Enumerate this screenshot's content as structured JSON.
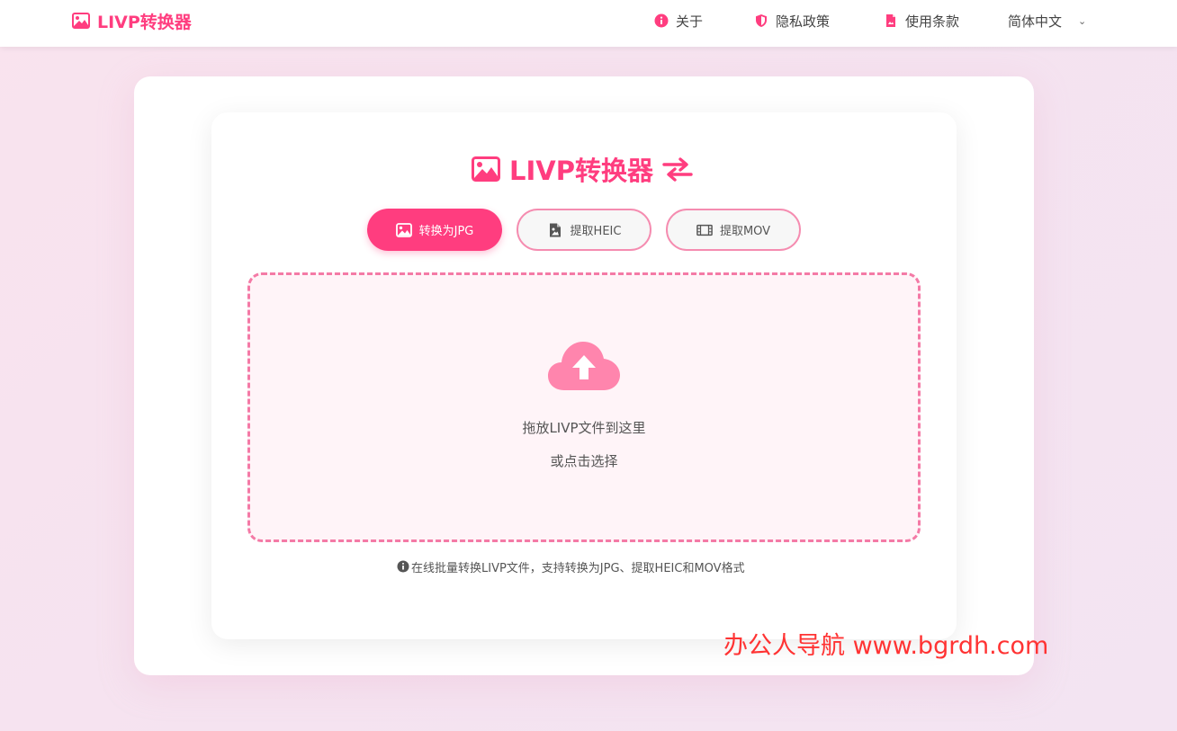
{
  "header": {
    "brand": "LIVP转换器",
    "nav": {
      "about": "关于",
      "privacy": "隐私政策",
      "terms": "使用条款",
      "language": "简体中文"
    }
  },
  "main": {
    "title": "LIVP转换器",
    "tabs": {
      "jpg": "转换为JPG",
      "heic": "提取HEIC",
      "mov": "提取MOV"
    },
    "dropzone": {
      "line1": "拖放LIVP文件到这里",
      "line2": "或点击选择"
    },
    "footnote": "在线批量转换LIVP文件，支持转换为JPG、提取HEIC和MOV格式"
  },
  "watermark": "办公人导航 www.bgrdh.com",
  "colors": {
    "accent": "#ff3d7f",
    "cloud": "#ff85ad",
    "dropzone_border": "#f47aa6"
  }
}
